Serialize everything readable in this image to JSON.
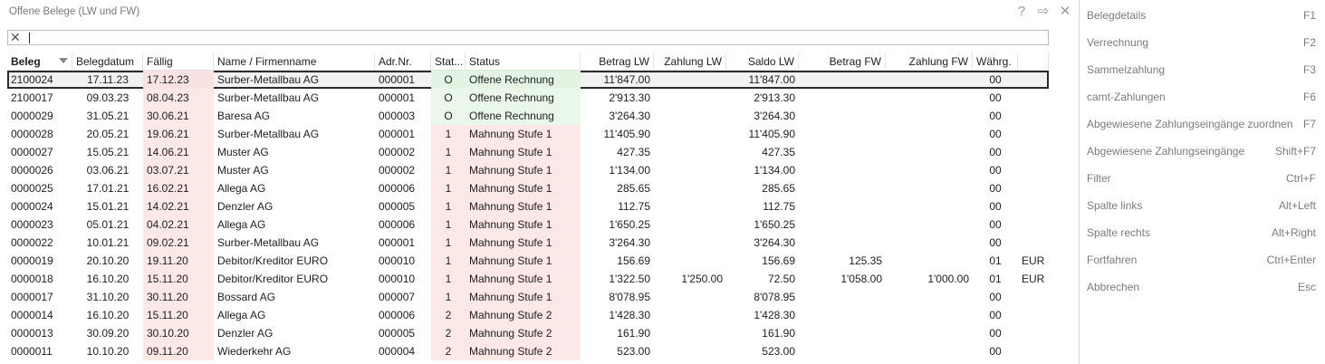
{
  "window": {
    "title": "Offene Belege (LW und FW)"
  },
  "title_icons": {
    "help": "?",
    "forward": "⇨",
    "close": "✕"
  },
  "search": {
    "value": ""
  },
  "columns": [
    {
      "label": "Beleg",
      "bold": true
    },
    {
      "label": "Belegdatum"
    },
    {
      "label": "Fällig"
    },
    {
      "label": "Name / Firmenname"
    },
    {
      "label": "Adr.Nr."
    },
    {
      "label": "Stat..."
    },
    {
      "label": "Status"
    },
    {
      "label": "Betrag LW"
    },
    {
      "label": "Zahlung LW"
    },
    {
      "label": "Saldo LW"
    },
    {
      "label": "Betrag FW"
    },
    {
      "label": "Zahlung FW"
    },
    {
      "label": "Währg."
    },
    {
      "label": ""
    }
  ],
  "rows": [
    {
      "beleg": "2100024",
      "belegdatum": "17.11.23",
      "faellig": "17.12.23",
      "name": "Surber-Metallbau AG",
      "adr": "000001",
      "stat": "O",
      "status": "Offene Rechnung",
      "betrag_lw": "11'847.00",
      "zahlung_lw": "",
      "saldo_lw": "11'847.00",
      "betrag_fw": "",
      "zahlung_fw": "",
      "waehrg": "00",
      "cur": "",
      "color": "green",
      "selected": true
    },
    {
      "beleg": "2100017",
      "belegdatum": "09.03.23",
      "faellig": "08.04.23",
      "name": "Surber-Metallbau AG",
      "adr": "000001",
      "stat": "O",
      "status": "Offene Rechnung",
      "betrag_lw": "2'913.30",
      "zahlung_lw": "",
      "saldo_lw": "2'913.30",
      "betrag_fw": "",
      "zahlung_fw": "",
      "waehrg": "00",
      "cur": "",
      "color": "green"
    },
    {
      "beleg": "0000029",
      "belegdatum": "31.05.21",
      "faellig": "30.06.21",
      "name": "Baresa  AG",
      "adr": "000003",
      "stat": "O",
      "status": "Offene Rechnung",
      "betrag_lw": "3'264.30",
      "zahlung_lw": "",
      "saldo_lw": "3'264.30",
      "betrag_fw": "",
      "zahlung_fw": "",
      "waehrg": "00",
      "cur": "",
      "color": "green"
    },
    {
      "beleg": "0000028",
      "belegdatum": "20.05.21",
      "faellig": "19.06.21",
      "name": "Surber-Metallbau AG",
      "adr": "000001",
      "stat": "1",
      "status": "Mahnung Stufe 1",
      "betrag_lw": "11'405.90",
      "zahlung_lw": "",
      "saldo_lw": "11'405.90",
      "betrag_fw": "",
      "zahlung_fw": "",
      "waehrg": "00",
      "cur": "",
      "color": "red"
    },
    {
      "beleg": "0000027",
      "belegdatum": "15.05.21",
      "faellig": "14.06.21",
      "name": "Muster AG",
      "adr": "000002",
      "stat": "1",
      "status": "Mahnung Stufe 1",
      "betrag_lw": "427.35",
      "zahlung_lw": "",
      "saldo_lw": "427.35",
      "betrag_fw": "",
      "zahlung_fw": "",
      "waehrg": "00",
      "cur": "",
      "color": "red"
    },
    {
      "beleg": "0000026",
      "belegdatum": "03.06.21",
      "faellig": "03.07.21",
      "name": "Muster AG",
      "adr": "000002",
      "stat": "1",
      "status": "Mahnung Stufe 1",
      "betrag_lw": "1'134.00",
      "zahlung_lw": "",
      "saldo_lw": "1'134.00",
      "betrag_fw": "",
      "zahlung_fw": "",
      "waehrg": "00",
      "cur": "",
      "color": "red"
    },
    {
      "beleg": "0000025",
      "belegdatum": "17.01.21",
      "faellig": "16.02.21",
      "name": "Allega AG",
      "adr": "000006",
      "stat": "1",
      "status": "Mahnung Stufe 1",
      "betrag_lw": "285.65",
      "zahlung_lw": "",
      "saldo_lw": "285.65",
      "betrag_fw": "",
      "zahlung_fw": "",
      "waehrg": "00",
      "cur": "",
      "color": "red"
    },
    {
      "beleg": "0000024",
      "belegdatum": "15.01.21",
      "faellig": "14.02.21",
      "name": "Denzler AG",
      "adr": "000005",
      "stat": "1",
      "status": "Mahnung Stufe 1",
      "betrag_lw": "112.75",
      "zahlung_lw": "",
      "saldo_lw": "112.75",
      "betrag_fw": "",
      "zahlung_fw": "",
      "waehrg": "00",
      "cur": "",
      "color": "red"
    },
    {
      "beleg": "0000023",
      "belegdatum": "05.01.21",
      "faellig": "04.02.21",
      "name": "Allega AG",
      "adr": "000006",
      "stat": "1",
      "status": "Mahnung Stufe 1",
      "betrag_lw": "1'650.25",
      "zahlung_lw": "",
      "saldo_lw": "1'650.25",
      "betrag_fw": "",
      "zahlung_fw": "",
      "waehrg": "00",
      "cur": "",
      "color": "red"
    },
    {
      "beleg": "0000022",
      "belegdatum": "10.01.21",
      "faellig": "09.02.21",
      "name": "Surber-Metallbau AG",
      "adr": "000001",
      "stat": "1",
      "status": "Mahnung Stufe 1",
      "betrag_lw": "3'264.30",
      "zahlung_lw": "",
      "saldo_lw": "3'264.30",
      "betrag_fw": "",
      "zahlung_fw": "",
      "waehrg": "00",
      "cur": "",
      "color": "red"
    },
    {
      "beleg": "0000019",
      "belegdatum": "20.10.20",
      "faellig": "19.11.20",
      "name": "Debitor/Kreditor EURO",
      "adr": "000010",
      "stat": "1",
      "status": "Mahnung Stufe 1",
      "betrag_lw": "156.69",
      "zahlung_lw": "",
      "saldo_lw": "156.69",
      "betrag_fw": "125.35",
      "zahlung_fw": "",
      "waehrg": "01",
      "cur": "EUR",
      "color": "red"
    },
    {
      "beleg": "0000018",
      "belegdatum": "16.10.20",
      "faellig": "15.11.20",
      "name": "Debitor/Kreditor EURO",
      "adr": "000010",
      "stat": "1",
      "status": "Mahnung Stufe 1",
      "betrag_lw": "1'322.50",
      "zahlung_lw": "1'250.00",
      "saldo_lw": "72.50",
      "betrag_fw": "1'058.00",
      "zahlung_fw": "1'000.00",
      "waehrg": "01",
      "cur": "EUR",
      "color": "red"
    },
    {
      "beleg": "0000017",
      "belegdatum": "31.10.20",
      "faellig": "30.11.20",
      "name": "Bossard AG",
      "adr": "000007",
      "stat": "1",
      "status": "Mahnung Stufe 1",
      "betrag_lw": "8'078.95",
      "zahlung_lw": "",
      "saldo_lw": "8'078.95",
      "betrag_fw": "",
      "zahlung_fw": "",
      "waehrg": "00",
      "cur": "",
      "color": "red"
    },
    {
      "beleg": "0000014",
      "belegdatum": "16.10.20",
      "faellig": "15.11.20",
      "name": "Allega AG",
      "adr": "000006",
      "stat": "2",
      "status": "Mahnung Stufe 2",
      "betrag_lw": "1'428.30",
      "zahlung_lw": "",
      "saldo_lw": "1'428.30",
      "betrag_fw": "",
      "zahlung_fw": "",
      "waehrg": "00",
      "cur": "",
      "color": "red2"
    },
    {
      "beleg": "0000013",
      "belegdatum": "30.09.20",
      "faellig": "30.10.20",
      "name": "Denzler AG",
      "adr": "000005",
      "stat": "2",
      "status": "Mahnung Stufe 2",
      "betrag_lw": "161.90",
      "zahlung_lw": "",
      "saldo_lw": "161.90",
      "betrag_fw": "",
      "zahlung_fw": "",
      "waehrg": "00",
      "cur": "",
      "color": "red2"
    },
    {
      "beleg": "0000011",
      "belegdatum": "10.10.20",
      "faellig": "09.11.20",
      "name": "Wiederkehr AG",
      "adr": "000004",
      "stat": "2",
      "status": "Mahnung Stufe 2",
      "betrag_lw": "523.00",
      "zahlung_lw": "",
      "saldo_lw": "523.00",
      "betrag_fw": "",
      "zahlung_fw": "",
      "waehrg": "00",
      "cur": "",
      "color": "red2"
    }
  ],
  "side_menu": [
    {
      "label": "Belegdetails",
      "key": "F1"
    },
    {
      "label": "Verrechnung",
      "key": "F2"
    },
    {
      "label": "Sammelzahlung",
      "key": "F3"
    },
    {
      "label": "camt-Zahlungen",
      "key": "F6"
    },
    {
      "label": "Abgewiesene Zahlungseingänge zuordnen",
      "key": "F7"
    },
    {
      "label": "Abgewiesene Zahlungseingänge",
      "key": "Shift+F7"
    },
    {
      "label": "Filter",
      "key": "Ctrl+F"
    },
    {
      "label": "Spalte links",
      "key": "Alt+Left"
    },
    {
      "label": "Spalte rechts",
      "key": "Alt+Right"
    },
    {
      "label": "Fortfahren",
      "key": "Ctrl+Enter"
    },
    {
      "label": "Abbrechen",
      "key": "Esc"
    }
  ],
  "colors": {
    "status_open": "#eaf8ea",
    "status_reminder": "#fde8e8",
    "selection_border": "#2b2b2b"
  }
}
